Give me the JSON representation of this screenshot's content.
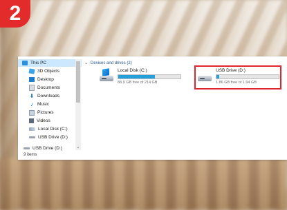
{
  "step_number": "2",
  "sidebar": {
    "items": [
      {
        "label": "This PC",
        "icon": "pc-icon",
        "selected": true
      },
      {
        "label": "3D Objects",
        "icon": "cube-icon"
      },
      {
        "label": "Desktop",
        "icon": "desktop-icon"
      },
      {
        "label": "Documents",
        "icon": "documents-icon"
      },
      {
        "label": "Downloads",
        "icon": "download-icon"
      },
      {
        "label": "Music",
        "icon": "music-icon"
      },
      {
        "label": "Pictures",
        "icon": "pictures-icon"
      },
      {
        "label": "Videos",
        "icon": "videos-icon"
      },
      {
        "label": "Local Disk (C:)",
        "icon": "local-disk-icon"
      },
      {
        "label": "USB Drive (D:)",
        "icon": "usb-drive-icon"
      },
      {
        "label": "USB Drive (D:)",
        "icon": "usb-drive-icon"
      }
    ]
  },
  "status_bar": {
    "item_count": "9 items"
  },
  "main": {
    "section_title": "Devices and drives (2)",
    "drives": [
      {
        "name": "Local Disk (C:)",
        "free_text": "88.9 GB free of 214 GB",
        "used_fraction": 0.585,
        "icon": "windows-drive-icon"
      },
      {
        "name": "USB Drive (D:)",
        "free_text": "1.86 GB free of 1.94 GB",
        "used_fraction": 0.04,
        "icon": "usb-drive-icon",
        "highlighted": true
      }
    ]
  },
  "colors": {
    "badge": "#e32b2b",
    "highlight": "#e0242b",
    "bar_fill": "#26a0da",
    "selection": "#cce8ff"
  }
}
